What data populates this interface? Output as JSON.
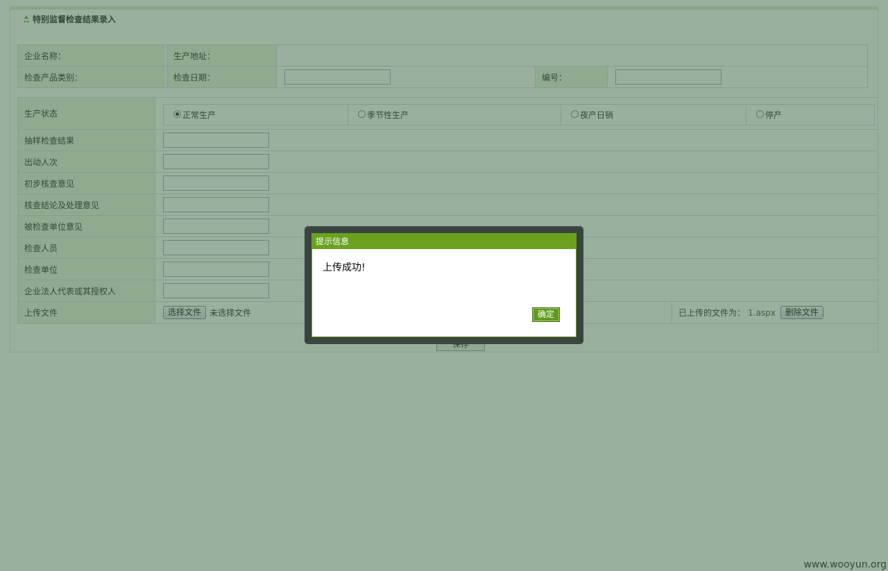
{
  "page": {
    "title": "特别监督检查结果录入",
    "watermark": "www.wooyun.org"
  },
  "info": {
    "company_name_label": "企业名称：",
    "production_address_label": "生产地址：",
    "product_category_label": "检查产品类别：",
    "inspection_date_label": "检查日期：",
    "number_label": "编号："
  },
  "form": {
    "production_status_label": "生产状态",
    "status_options": [
      "正常生产",
      "季节性生产",
      "夜产日销",
      "停产"
    ],
    "selected_status": "正常生产",
    "fields": [
      "抽样检查结果",
      "出动人次",
      "初步核查意见",
      "核查结论及处理意见",
      "被检查单位意见",
      "检查人员",
      "检查单位",
      "企业法人代表或其授权人"
    ],
    "upload_label": "上传文件",
    "choose_file_button": "选择文件",
    "no_file_text": "未选择文件",
    "uploaded_label": "已上传的文件为：",
    "uploaded_file": "1.aspx",
    "delete_file_button": "删除文件",
    "save_button": "保存"
  },
  "dialog": {
    "title": "提示信息",
    "message": "上传成功!",
    "ok_button": "确定"
  },
  "colors": {
    "overlay": "#355f3d",
    "dialog_header": "#6aa220",
    "label_cell": "#eaf5e0"
  }
}
